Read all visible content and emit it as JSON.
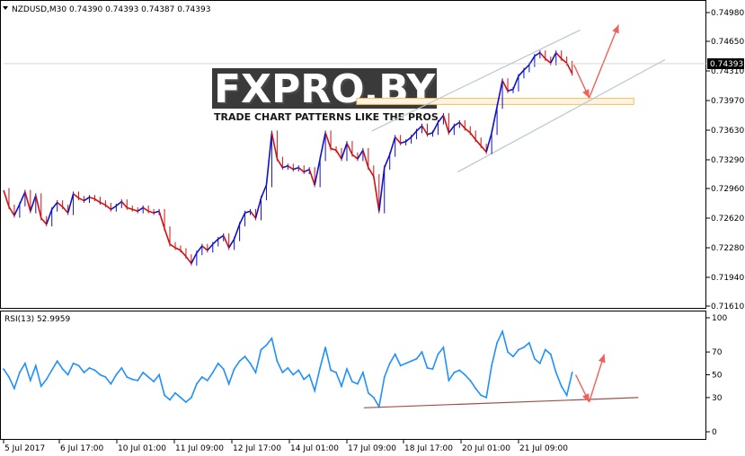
{
  "colors": {
    "bull_candle": "#1010c8",
    "bear_candle": "#d01010",
    "rsi_line": "#1e90ff",
    "channel": "#b9c7d0",
    "arrow": "#f0605a",
    "rsi_trend": "#a0504a",
    "zone_border": "#f0c060",
    "zone_fill": "#fdf3df",
    "price_tag_bg": "#000000",
    "price_tag_text": "#ffffff"
  },
  "header": {
    "symbol_line": "NZDUSD,M30  0.74390 0.74393 0.74387 0.74393"
  },
  "watermark": {
    "logo": "FXPRO.BY",
    "tagline": "TRADE CHART PATTERNS LIKE THE PROS"
  },
  "chart_data": [
    {
      "type": "line",
      "title": "",
      "series": [
        {
          "name": "NZDUSD,M30",
          "x": [
            0,
            6,
            12,
            18,
            24,
            30,
            36,
            42,
            48,
            54,
            60,
            66,
            72,
            78,
            84,
            90,
            96,
            102,
            108,
            114,
            120,
            126,
            132,
            138,
            144,
            150,
            156,
            162,
            168,
            174,
            180,
            186,
            192,
            198,
            204,
            210,
            216,
            222,
            228,
            234,
            240,
            246,
            252,
            258,
            264,
            270,
            276,
            282,
            288,
            294,
            300,
            306,
            312,
            318,
            324,
            330,
            336,
            342,
            348,
            354,
            360,
            366,
            372,
            378,
            384,
            390,
            396,
            402,
            408,
            414,
            420,
            426,
            432,
            438,
            444,
            450,
            456,
            462,
            468,
            474,
            480,
            486,
            492,
            498,
            504,
            510,
            516,
            522,
            528,
            534,
            540,
            546,
            552,
            558,
            564,
            570,
            576,
            582,
            588,
            594,
            600,
            606,
            612,
            618,
            624,
            630,
            636
          ],
          "values": [
            0.7294,
            0.7275,
            0.7265,
            0.7278,
            0.7292,
            0.727,
            0.7288,
            0.7262,
            0.7255,
            0.7272,
            0.728,
            0.7275,
            0.7268,
            0.729,
            0.7285,
            0.7282,
            0.7286,
            0.7284,
            0.728,
            0.7277,
            0.7272,
            0.7276,
            0.7281,
            0.7274,
            0.7272,
            0.727,
            0.7274,
            0.727,
            0.7268,
            0.727,
            0.725,
            0.7232,
            0.7228,
            0.7225,
            0.7218,
            0.721,
            0.7222,
            0.723,
            0.7225,
            0.7232,
            0.7238,
            0.7242,
            0.7228,
            0.7238,
            0.7255,
            0.7268,
            0.727,
            0.7262,
            0.7285,
            0.73,
            0.736,
            0.733,
            0.732,
            0.7322,
            0.7318,
            0.732,
            0.7315,
            0.7318,
            0.73,
            0.733,
            0.736,
            0.7342,
            0.734,
            0.733,
            0.7348,
            0.7335,
            0.733,
            0.734,
            0.732,
            0.731,
            0.727,
            0.732,
            0.7335,
            0.7355,
            0.7348,
            0.735,
            0.7355,
            0.7362,
            0.7368,
            0.7358,
            0.736,
            0.7372,
            0.738,
            0.736,
            0.7368,
            0.7372,
            0.7365,
            0.736,
            0.7352,
            0.7345,
            0.7338,
            0.736,
            0.739,
            0.742,
            0.7408,
            0.741,
            0.7425,
            0.7432,
            0.7438,
            0.7448,
            0.7452,
            0.7445,
            0.744,
            0.7452,
            0.7445,
            0.744,
            0.7428
          ]
        }
      ],
      "x_tick_labels": [
        "5 Jul 2017",
        "6 Jul 17:00",
        "10 Jul 01:00",
        "11 Jul 09:00",
        "12 Jul 17:00",
        "14 Jul 01:00",
        "17 Jul 09:00",
        "18 Jul 17:00",
        "20 Jul 01:00",
        "21 Jul 09:00"
      ],
      "y_tick_labels": [
        "0.74980",
        "0.74650",
        "0.74310",
        "0.73970",
        "0.73630",
        "0.73290",
        "0.72960",
        "0.72620",
        "0.72280",
        "0.71940",
        "0.71610"
      ],
      "ylim": [
        0.7161,
        0.7498
      ],
      "current_price_label": "0.74393",
      "current_price": 0.74393,
      "resistance_zone": [
        0.73925,
        0.73995
      ],
      "channel_upper": [
        [
          412,
          0.7362
        ],
        [
          645,
          0.7478
        ]
      ],
      "channel_lower": [
        [
          508,
          0.7315
        ],
        [
          740,
          0.7444
        ]
      ],
      "arrow_down": [
        [
          638,
          0.7438
        ],
        [
          655,
          0.74
        ]
      ],
      "arrow_up": [
        [
          655,
          0.74
        ],
        [
          688,
          0.7484
        ]
      ],
      "grid": false
    },
    {
      "type": "line",
      "title": "RSI(13) 52.9959",
      "series": [
        {
          "name": "RSI(13) 52.9959",
          "x": [
            0,
            6,
            12,
            18,
            24,
            30,
            36,
            42,
            48,
            54,
            60,
            66,
            72,
            78,
            84,
            90,
            96,
            102,
            108,
            114,
            120,
            126,
            132,
            138,
            144,
            150,
            156,
            162,
            168,
            174,
            180,
            186,
            192,
            198,
            204,
            210,
            216,
            222,
            228,
            234,
            240,
            246,
            252,
            258,
            264,
            270,
            276,
            282,
            288,
            294,
            300,
            306,
            312,
            318,
            324,
            330,
            336,
            342,
            348,
            354,
            360,
            366,
            372,
            378,
            384,
            390,
            396,
            402,
            408,
            414,
            420,
            426,
            432,
            438,
            444,
            450,
            456,
            462,
            468,
            474,
            480,
            486,
            492,
            498,
            504,
            510,
            516,
            522,
            528,
            534,
            540,
            546,
            552,
            558,
            564,
            570,
            576,
            582,
            588,
            594,
            600,
            606,
            612,
            618,
            624,
            630,
            636
          ],
          "values": [
            55,
            48,
            38,
            52,
            60,
            45,
            58,
            40,
            46,
            54,
            62,
            55,
            50,
            60,
            58,
            52,
            56,
            54,
            50,
            48,
            42,
            50,
            56,
            48,
            46,
            45,
            52,
            48,
            44,
            50,
            32,
            28,
            34,
            30,
            26,
            30,
            42,
            48,
            45,
            52,
            60,
            55,
            42,
            55,
            62,
            66,
            60,
            52,
            72,
            76,
            82,
            62,
            52,
            56,
            50,
            54,
            46,
            50,
            36,
            56,
            74,
            54,
            52,
            40,
            55,
            44,
            42,
            52,
            34,
            30,
            22,
            48,
            60,
            68,
            58,
            60,
            62,
            64,
            70,
            56,
            55,
            68,
            74,
            45,
            52,
            54,
            50,
            45,
            38,
            32,
            30,
            58,
            78,
            88,
            70,
            66,
            72,
            74,
            78,
            64,
            60,
            72,
            68,
            52,
            40,
            32,
            52
          ],
          "color": "#1e90ff"
        }
      ],
      "y_tick_labels": [
        "100",
        "70",
        "50",
        "30",
        "0"
      ],
      "ylim": [
        0,
        100
      ],
      "trendline": [
        [
          403,
          21
        ],
        [
          710,
          30
        ]
      ],
      "arrow_down": [
        [
          640,
          50
        ],
        [
          655,
          26
        ]
      ],
      "arrow_up": [
        [
          655,
          26
        ],
        [
          672,
          68
        ]
      ],
      "grid": false
    }
  ]
}
